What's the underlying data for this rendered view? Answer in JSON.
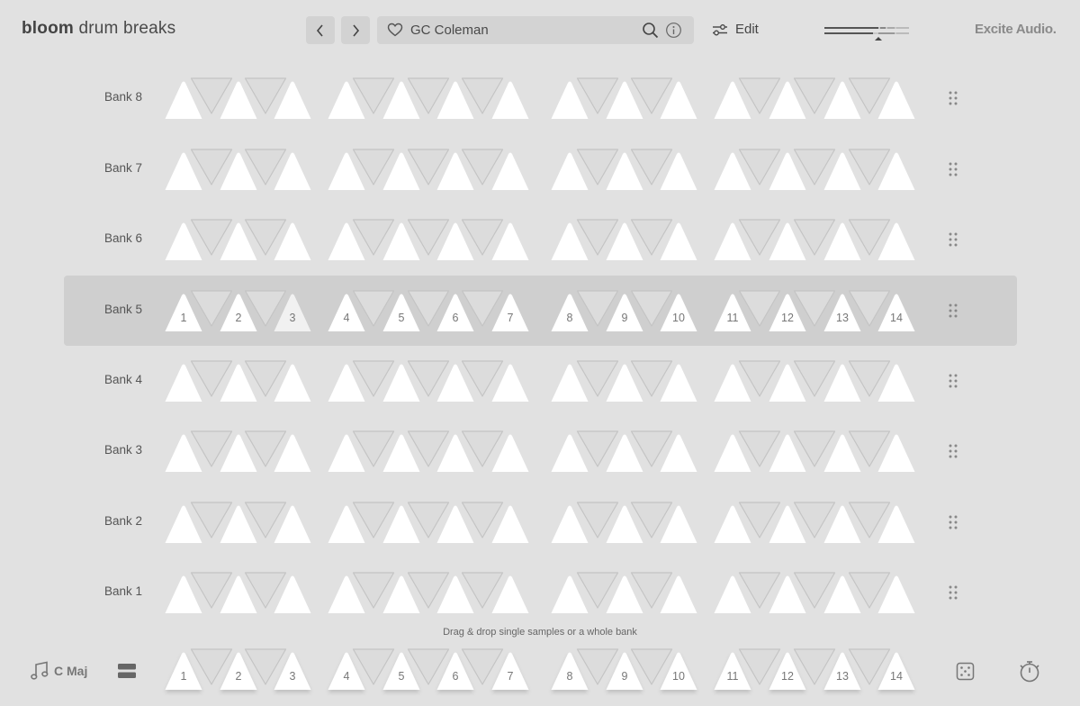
{
  "header": {
    "logo_bold": "bloom",
    "logo_light": "drum breaks",
    "prev_icon": "chevron-left-icon",
    "next_icon": "chevron-right-icon",
    "favorite_icon": "heart-icon",
    "preset_name": "GC Coleman",
    "search_icon": "search-icon",
    "info_icon": "info-icon",
    "edit_label": "Edit",
    "edit_icon": "sliders-icon",
    "brand": "Excite Audio."
  },
  "banks": [
    {
      "label": "Bank 8",
      "selected": false
    },
    {
      "label": "Bank 7",
      "selected": false
    },
    {
      "label": "Bank 6",
      "selected": false
    },
    {
      "label": "Bank 5",
      "selected": true
    },
    {
      "label": "Bank 4",
      "selected": false
    },
    {
      "label": "Bank 3",
      "selected": false
    },
    {
      "label": "Bank 2",
      "selected": false
    },
    {
      "label": "Bank 1",
      "selected": false
    }
  ],
  "pad_numbers": [
    "1",
    "2",
    "3",
    "4",
    "5",
    "6",
    "7",
    "8",
    "9",
    "10",
    "11",
    "12",
    "13",
    "14"
  ],
  "hint": "Drag & drop single samples or a whole bank",
  "footer": {
    "key_label": "C Maj",
    "key_icon": "music-note-icon",
    "bank_view_icon": "stacked-banks-icon",
    "randomize_icon": "dice-icon",
    "timer_icon": "stopwatch-icon"
  },
  "colors": {
    "background": "#e1e1e1",
    "selected_row": "#cfcfcf",
    "pad_up": "#ffffff",
    "pad_down_fill": "#dcdcdc",
    "pad_down_stroke": "#c4c4c4"
  }
}
